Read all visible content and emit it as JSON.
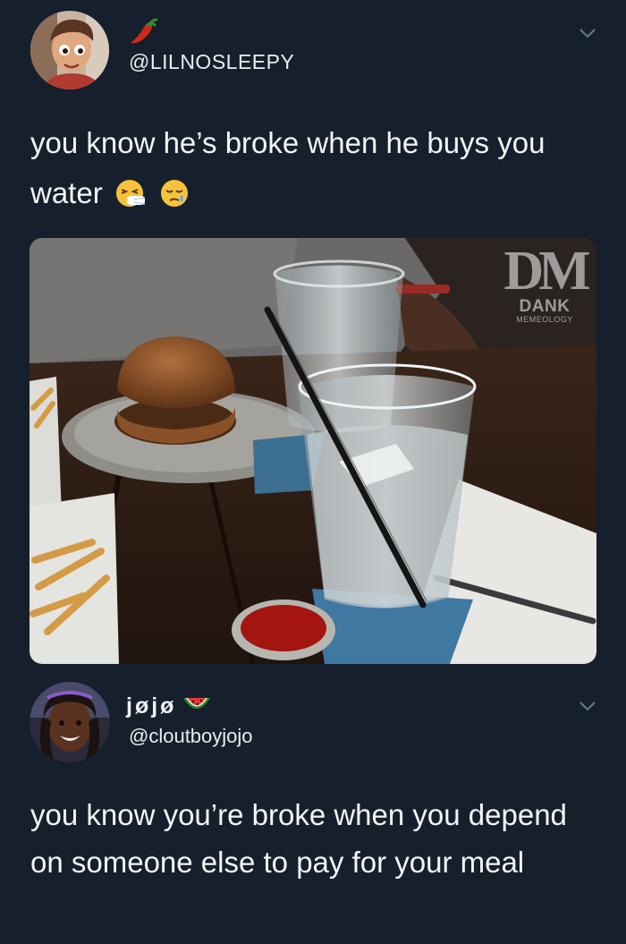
{
  "first_tweet": {
    "username": "@LILNOSLEEPY",
    "name_icon": "hot-pepper-icon",
    "text": "you know he’s broke when he buys you water",
    "text_emojis": [
      "sneezing-face-icon",
      "sleepy-face-icon"
    ],
    "media": {
      "description_icon": "photo",
      "watermark": {
        "logo": "DM",
        "brand": "DANK",
        "sub": "MEMEOLOGY"
      }
    }
  },
  "reply_tweet": {
    "display_name": "jøjø",
    "name_icon": "watermelon-icon",
    "handle": "@cloutboyjojo",
    "text": "you know you’re broke when you depend on someone else to pay for your meal"
  },
  "colors": {
    "background": "#16202c",
    "text": "#e8edf2",
    "chevron": "#6b7a89"
  }
}
